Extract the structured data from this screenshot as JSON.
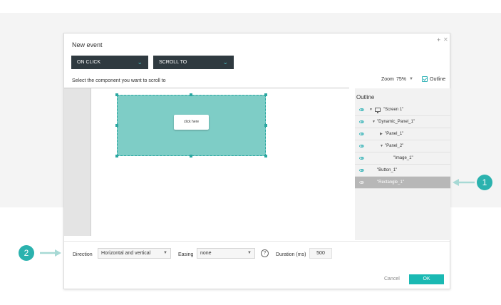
{
  "dialog": {
    "title": "New event",
    "plus_glyph": "+",
    "close_glyph": "✕"
  },
  "toolbar": {
    "trigger": "ON CLICK",
    "action": "SCROLL TO"
  },
  "instruction": "Select the component you want to scroll to",
  "zoom": {
    "label": "Zoom",
    "value": "75%",
    "outline_toggle_label": "Outline",
    "outline_checked": true
  },
  "canvas": {
    "button_label": "click here"
  },
  "outline": {
    "title": "Outline",
    "items": [
      {
        "label": "\"Screen 1\""
      },
      {
        "label": "\"Dynamic_Panel_1\""
      },
      {
        "label": "\"Panel_1\""
      },
      {
        "label": "\"Panel_2\""
      },
      {
        "label": "\"Image_1\""
      },
      {
        "label": "\"Button_1\""
      },
      {
        "label": "\"Rectangle_1\""
      }
    ]
  },
  "scroll_options": {
    "direction_label": "Direction",
    "direction_value": "Horizontal and vertical",
    "easing_label": "Easing",
    "easing_value": "none",
    "help_glyph": "?",
    "duration_label": "Duration (ms)",
    "duration_value": "500"
  },
  "footer": {
    "cancel_label": "Cancel",
    "ok_label": "OK"
  },
  "callouts": {
    "one": "1",
    "two": "2"
  },
  "colors": {
    "accent": "#1ab9b3",
    "dropdown_bg": "#2f3a40",
    "rectangle_fill": "#7ecdc6",
    "selected_row": "#b7b7b7"
  },
  "icons": {
    "eye": "eye-icon",
    "screen": "monitor-icon",
    "expand": "caret-down-icon",
    "collapse": "caret-right-icon",
    "help": "question-circle-icon",
    "check": "checkbox-checked-icon"
  }
}
